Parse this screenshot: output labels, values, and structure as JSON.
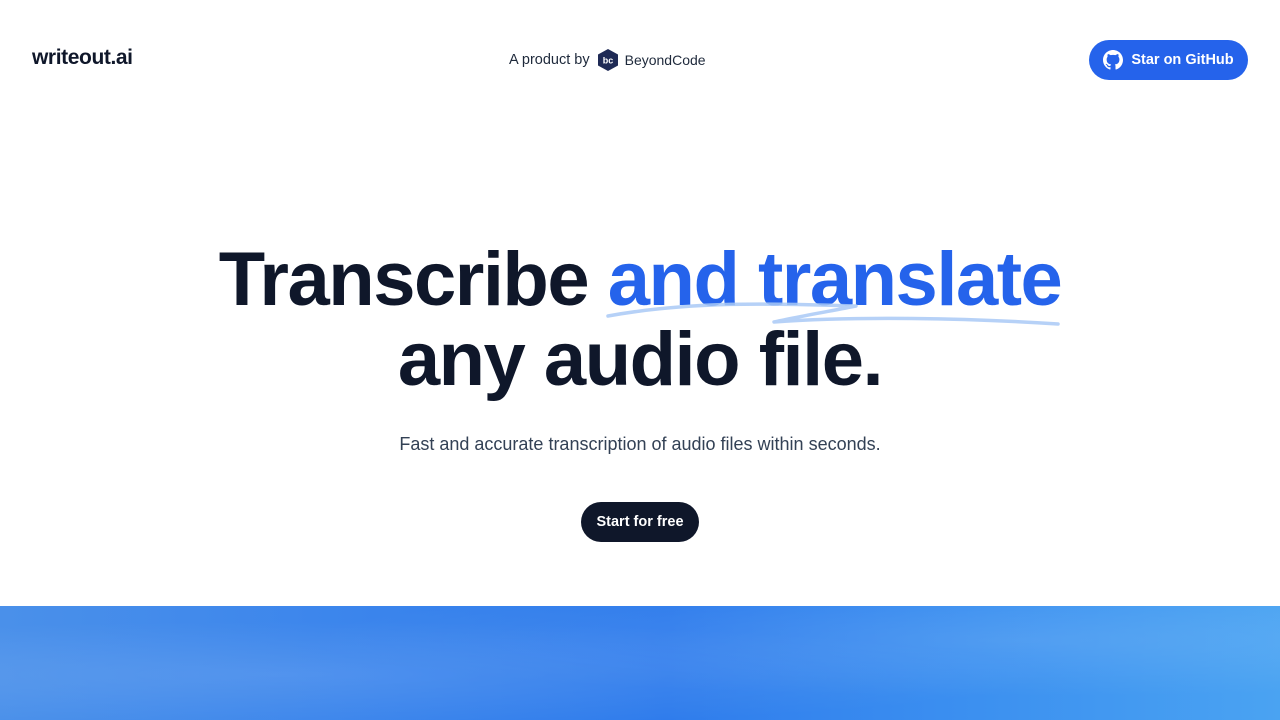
{
  "header": {
    "logo": "writeout.ai",
    "byline_prefix": "A product by",
    "company_name": "BeyondCode",
    "company_icon": "beyondcode-hex-logo-icon",
    "github_button_label": "Star on GitHub",
    "github_icon": "github-icon"
  },
  "hero": {
    "headline_part1": "Transcribe",
    "headline_accent": "and translate",
    "headline_line2": "any audio file.",
    "subtitle": "Fast and accurate transcription of audio files within seconds.",
    "cta_label": "Start for free"
  },
  "colors": {
    "accent": "#2563eb",
    "dark": "#0f172a",
    "banner": "#2f7cec"
  }
}
